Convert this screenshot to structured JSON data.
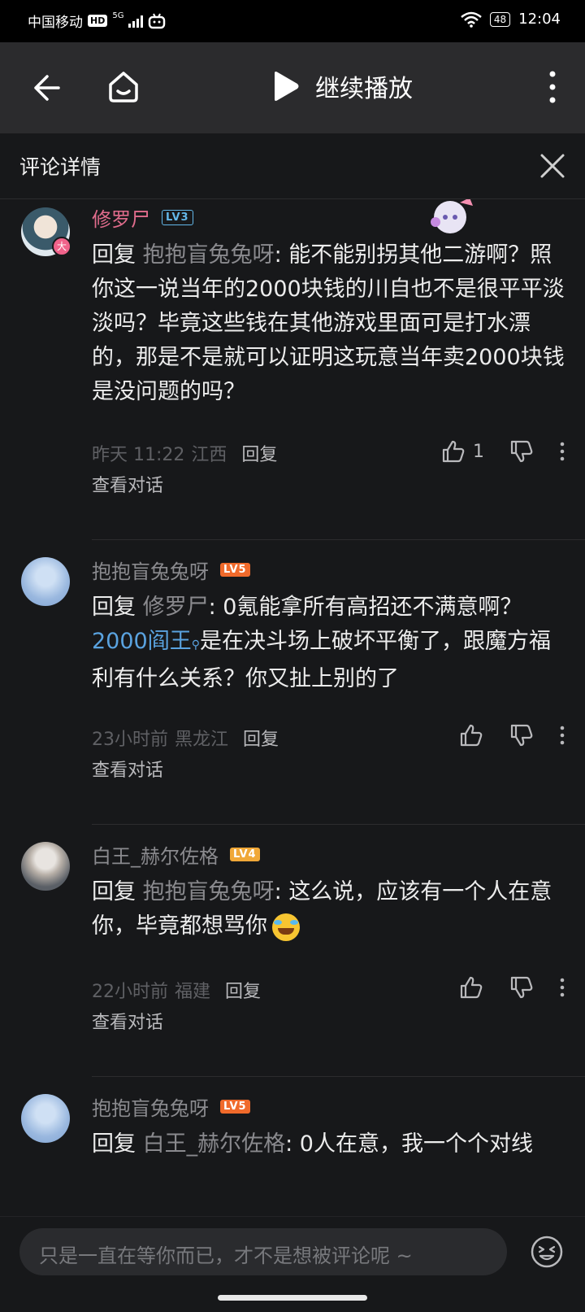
{
  "status_bar": {
    "carrier": "中国移动",
    "hd": "HD",
    "network": "5G",
    "battery": "48",
    "time": "12:04"
  },
  "top_bar": {
    "continue_play_label": "继续播放"
  },
  "panel": {
    "title": "评论详情"
  },
  "comments": [
    {
      "username": "修罗尸",
      "level": "LV3",
      "level_color": "#63b7e9",
      "name_color": "#e06c8c",
      "reply_word": "回复",
      "reply_to": "抱抱盲兔兔呀",
      "text": ": 能不能别拐其他二游啊？照你这一说当年的2000块钱的川自也不是很平平淡淡吗？毕竟这些钱在其他游戏里面可是打水漂的，那是不是就可以证明这玩意当年卖2000块钱是没问题的吗？",
      "time": "昨天 11:22",
      "location": "江西",
      "reply_label": "回复",
      "likes": "1",
      "view_conversation": "查看对话",
      "badge": "大"
    },
    {
      "username": "抱抱盲兔兔呀",
      "level": "LV5",
      "level_color": "#f06a2b",
      "name_color": "#8a8a8e",
      "reply_word": "回复",
      "reply_to": "修罗尸",
      "text_before": ": 0氪能拿所有高招还不满意啊？",
      "link": "2000阎王",
      "text_after": "是在决斗场上破坏平衡了，跟魔方福利有什么关系？你又扯上别的了",
      "time": "23小时前",
      "location": "黑龙江",
      "reply_label": "回复",
      "view_conversation": "查看对话"
    },
    {
      "username": "白王_赫尔佐格",
      "level": "LV4",
      "level_color": "#f0a838",
      "name_color": "#8a8a8e",
      "reply_word": "回复",
      "reply_to": "抱抱盲兔兔呀",
      "text": ": 这么说，应该有一个人在意你，毕竟都想骂你",
      "time": "22小时前",
      "location": "福建",
      "reply_label": "回复",
      "view_conversation": "查看对话"
    },
    {
      "username": "抱抱盲兔兔呀",
      "level": "LV5",
      "level_color": "#f06a2b",
      "name_color": "#8a8a8e",
      "reply_word": "回复",
      "reply_to": "白王_赫尔佐格",
      "text": ": 0人在意，我一个个对线"
    }
  ],
  "input": {
    "placeholder": "只是一直在等你而已，才不是想被评论呢 ~"
  },
  "icons": {
    "back": "back-arrow-icon",
    "home": "home-icon",
    "play": "play-icon",
    "more": "more-vertical-icon",
    "close": "close-icon",
    "like": "thumb-up-icon",
    "dislike": "thumb-down-icon",
    "emoji": "emoji-icon"
  }
}
